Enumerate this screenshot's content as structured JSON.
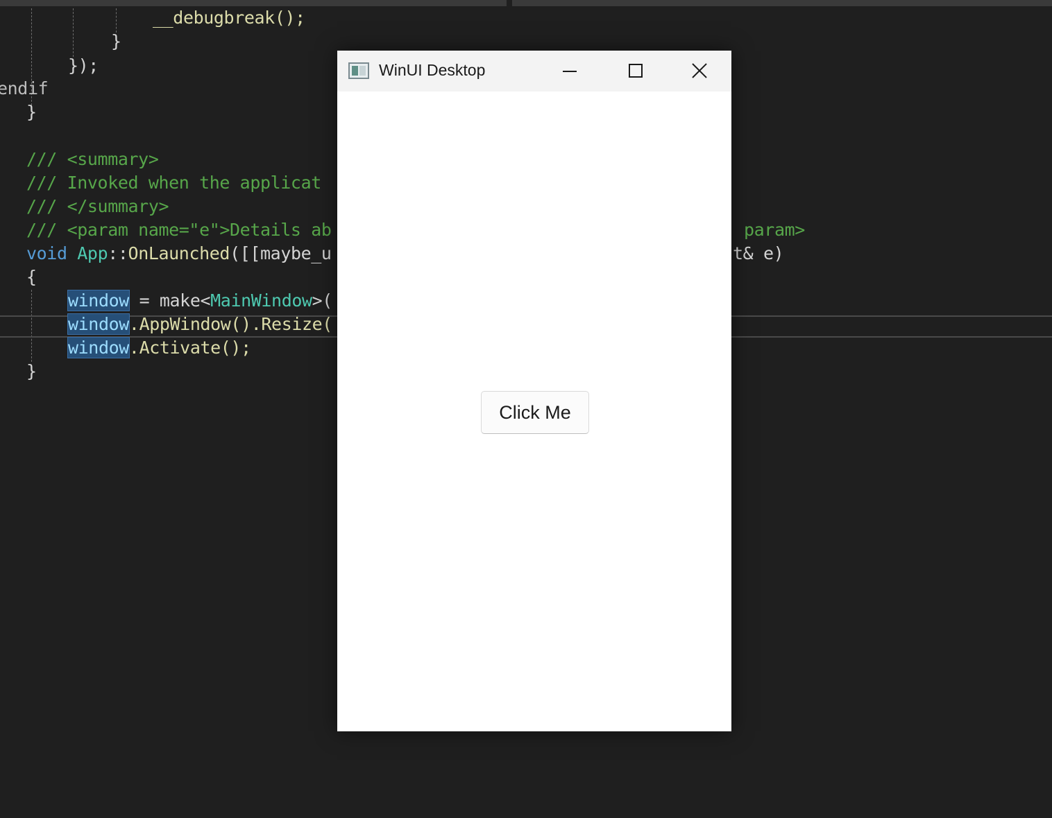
{
  "app_window": {
    "title": "WinUI Desktop",
    "button_label": "Click Me"
  },
  "editor": {
    "lines": [
      "__debugbreak();",
      "}",
      "});",
      "endif",
      "}",
      "/// <summary>",
      "/// Invoked when the applicat",
      "/// </summary>",
      "/// <param name=\"e\">Details ab",
      "param>",
      "void",
      "App",
      "::",
      "OnLaunched",
      "([[maybe_u",
      "t& e)",
      "{",
      "window",
      " = make<",
      "MainWindow",
      ">(",
      "window",
      ".AppWindow().Resize(",
      "window",
      ".Activate();",
      "}"
    ]
  },
  "colors": {
    "editor_bg": "#1f1f1f",
    "comment": "#57a64a",
    "keyword": "#569cd6",
    "type": "#4ec9b0",
    "selection": "#264f78",
    "window_bg": "#ffffff",
    "titlebar_bg": "#f3f3f3"
  }
}
